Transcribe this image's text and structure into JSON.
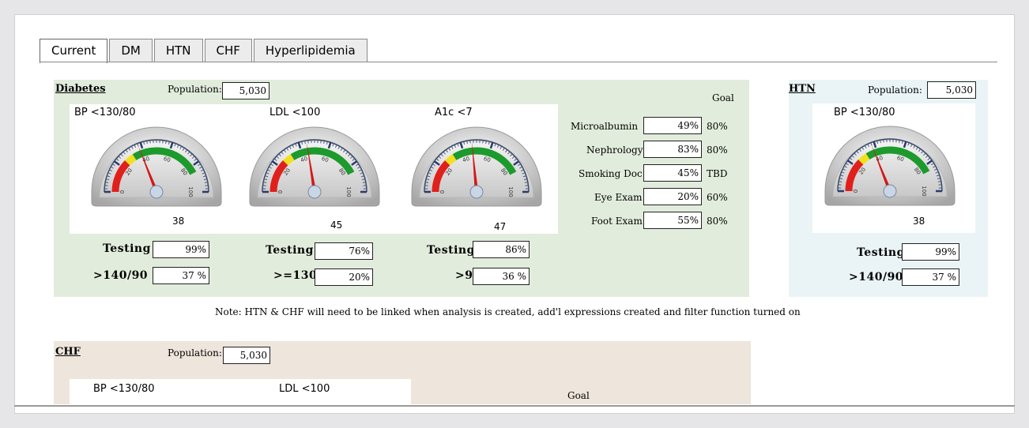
{
  "tabs": [
    "Current",
    "DM",
    "HTN",
    "CHF",
    "Hyperlipidemia"
  ],
  "diabetes": {
    "title": "Diabetes",
    "population_label": "Population:",
    "population": "5,030",
    "goal_header": "Goal",
    "gauges": [
      {
        "label": "BP  <130/80",
        "value": "38",
        "reading": 38
      },
      {
        "label": "LDL  <100",
        "value": "45",
        "reading": 45
      },
      {
        "label": "A1c  <7",
        "value": "47",
        "reading": 47
      }
    ],
    "testing": [
      {
        "label": "Testing",
        "value": "99%"
      },
      {
        "label": "Testing",
        "value": "76%"
      },
      {
        "label": "Testing",
        "value": "86%"
      }
    ],
    "thresholds": [
      {
        "label": ">140/90",
        "value": "37 %"
      },
      {
        "label": ">=130",
        "value": "20%"
      },
      {
        "label": ">9",
        "value": "36 %"
      }
    ],
    "metrics": [
      {
        "label": "Microalbumin",
        "value": "49%",
        "goal": "80%"
      },
      {
        "label": "Nephrology",
        "value": "83%",
        "goal": "80%"
      },
      {
        "label": "Smoking Doc",
        "value": "45%",
        "goal": "TBD"
      },
      {
        "label": "Eye Exam",
        "value": "20%",
        "goal": "60%"
      },
      {
        "label": "Foot Exam",
        "value": "55%",
        "goal": "80%"
      }
    ]
  },
  "htn": {
    "title": "HTN",
    "population_label": "Population:",
    "population": "5,030",
    "gauge": {
      "label": "BP  <130/80",
      "value": "38",
      "reading": 38
    },
    "testing": {
      "label": "Testing",
      "value": "99%"
    },
    "threshold": {
      "label": ">140/90",
      "value": "37 %"
    }
  },
  "note": "Note: HTN & CHF will need to be linked when analysis is created, add'l expressions created and filter function turned on",
  "chf": {
    "title": "CHF",
    "population_label": "Population:",
    "population": "5,030",
    "gauge_labels": [
      "BP  <130/80",
      "LDL  <100"
    ],
    "goal_header": "Goal"
  },
  "gauge_ticks": [
    "0",
    "20",
    "40",
    "60",
    "80",
    "100"
  ],
  "colors": {
    "red": "#e0201c",
    "yellow": "#f2e01c",
    "green": "#1c9a2c",
    "needle": "#d21818"
  }
}
